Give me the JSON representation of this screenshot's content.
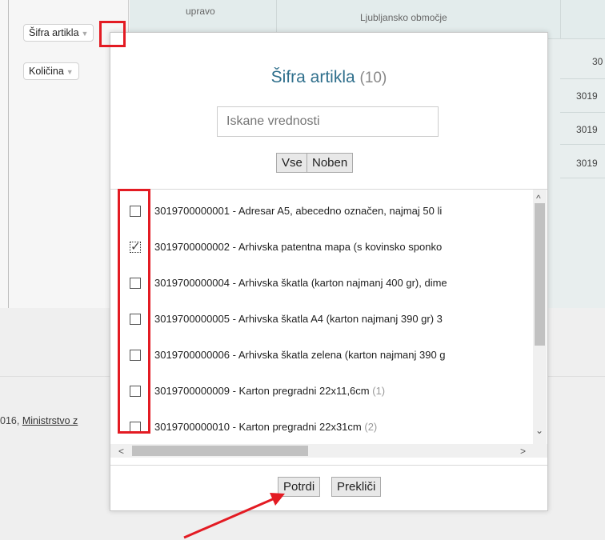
{
  "sidebar": {
    "fields": [
      {
        "label": "Šifra artikla"
      },
      {
        "label": "Količina"
      }
    ],
    "caret": "▼"
  },
  "grid": {
    "headers": [
      "upravo",
      "Ljubljansko območje"
    ],
    "cells": [
      "30",
      "3019",
      "3019",
      "3019"
    ]
  },
  "footer": {
    "text_prefix": "016, ",
    "link": "Ministrstvo z"
  },
  "filter_dialog": {
    "title": "Šifra artikla",
    "count": "(10)",
    "search_placeholder": "Iskane vrednosti",
    "select_all_label": "Vse",
    "select_none_label": "Noben",
    "items": [
      {
        "text": "3019700000001 - Adresar A5, abecedno označen, najmaj 50 li",
        "count": "",
        "checked": false
      },
      {
        "text": "3019700000002 - Arhivska patentna mapa (s kovinsko sponko",
        "count": "",
        "checked": true
      },
      {
        "text": "3019700000004 - Arhivska škatla (karton najmanj 400 gr), dime",
        "count": "",
        "checked": false
      },
      {
        "text": "3019700000005 - Arhivska škatla A4 (karton najmanj 390 gr) 3",
        "count": "",
        "checked": false
      },
      {
        "text": "3019700000006 - Arhivska škatla zelena (karton najmanj 390 g",
        "count": "",
        "checked": false
      },
      {
        "text": "3019700000009 - Karton pregradni 22x11,6cm",
        "count": "(1)",
        "checked": false
      },
      {
        "text": "3019700000010 - Karton pregradni 22x31cm",
        "count": "(2)",
        "checked": false
      }
    ],
    "confirm_label": "Potrdi",
    "cancel_label": "Prekliči"
  },
  "icons": {
    "scroll_up": "^",
    "scroll_down": "⌄",
    "scroll_left": "<",
    "scroll_right": ">"
  },
  "colors": {
    "title": "#2f6f8c",
    "annotation": "#e31b23"
  }
}
